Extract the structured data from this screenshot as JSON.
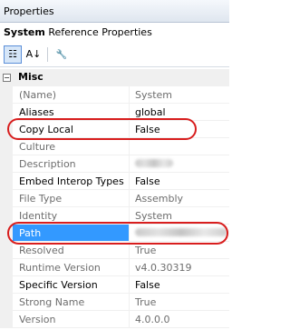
{
  "window": {
    "title": "Properties"
  },
  "object_selector": {
    "name": "System",
    "type": "Reference Properties"
  },
  "toolbar": {
    "categorized_glyph": "☷",
    "alphabetical_glyph": "A↓",
    "property_pages_glyph": "🔧"
  },
  "category": {
    "toggle": "−",
    "label": "Misc"
  },
  "properties": [
    {
      "name": "(Name)",
      "value": "System"
    },
    {
      "name": "Aliases",
      "value": "global"
    },
    {
      "name": "Copy Local",
      "value": "False"
    },
    {
      "name": "Culture",
      "value": ""
    },
    {
      "name": "Description",
      "value": ""
    },
    {
      "name": "Embed Interop Types",
      "value": "False"
    },
    {
      "name": "File Type",
      "value": "Assembly"
    },
    {
      "name": "Identity",
      "value": "System"
    },
    {
      "name": "Path",
      "value": ""
    },
    {
      "name": "Resolved",
      "value": "True"
    },
    {
      "name": "Runtime Version",
      "value": "v4.0.30319"
    },
    {
      "name": "Specific Version",
      "value": "False"
    },
    {
      "name": "Strong Name",
      "value": "True"
    },
    {
      "name": "Version",
      "value": "4.0.0.0"
    }
  ],
  "colors": {
    "selection": "#3399ff",
    "annotation": "#d81e1e",
    "readonly_text": "#6d6d6d"
  }
}
